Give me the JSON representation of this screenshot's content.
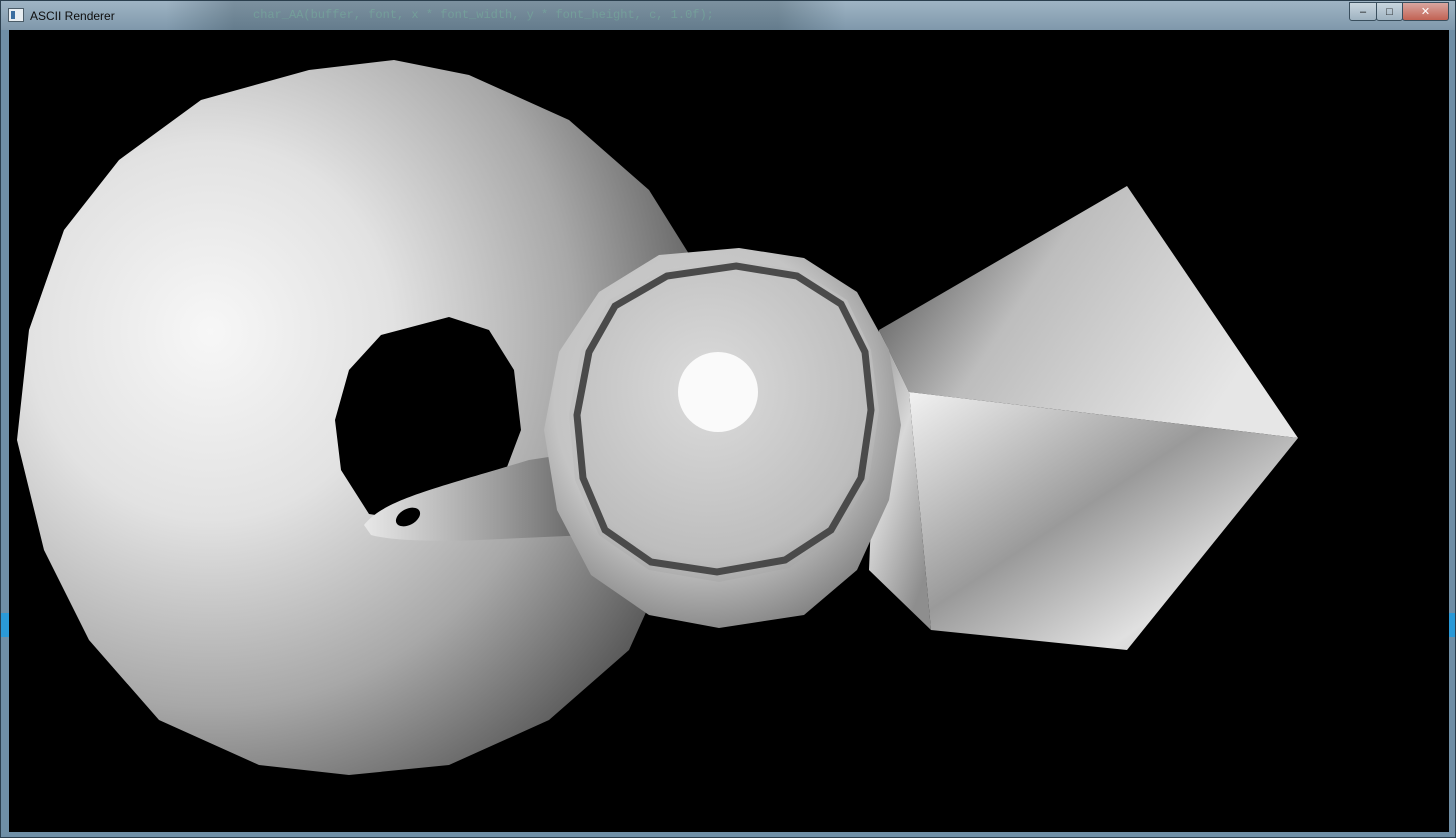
{
  "window": {
    "title": "ASCII Renderer",
    "icon": "app-window-icon",
    "controls": {
      "minimize": "–",
      "maximize": "□",
      "close": "✕"
    }
  },
  "background_code": {
    "text": "char_AA(buffer, font, x * font_width, y * font_height, c, 1.0f);"
  },
  "scene": {
    "background_color": "#000000",
    "objects": [
      "torus",
      "teapot",
      "cube"
    ]
  }
}
